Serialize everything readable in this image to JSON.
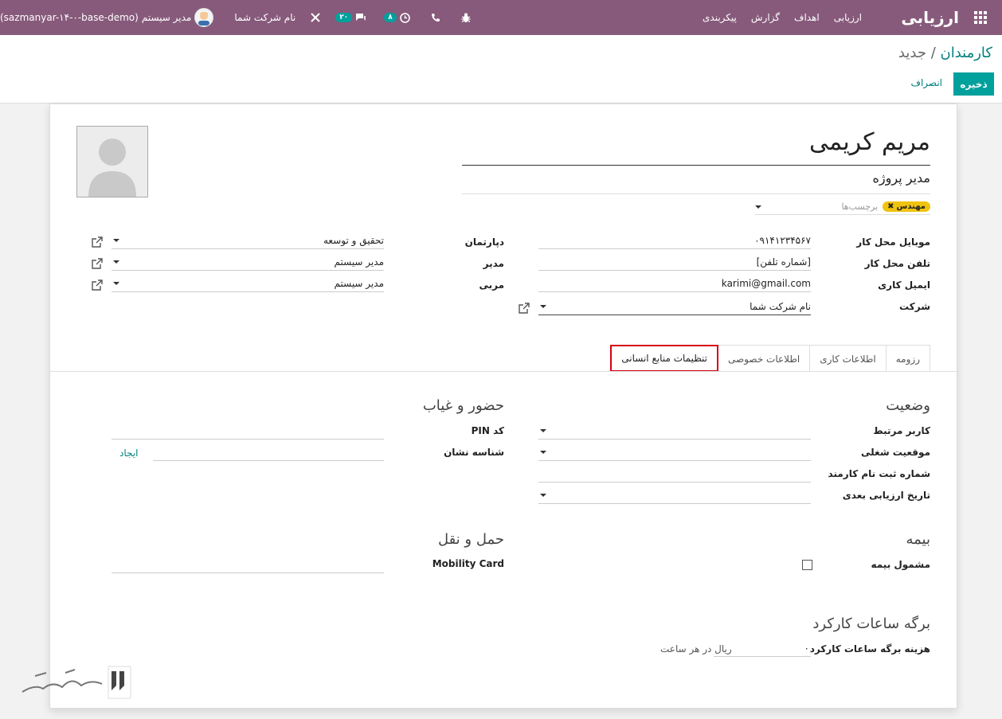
{
  "navbar": {
    "app_name": "ارزیابی",
    "menu": [
      "ارزیابی",
      "اهداف",
      "گزارش",
      "پیکربندی"
    ],
    "db_name": "(sazmanyar-۱۴-۰-base-demo)",
    "user_name": "مدیر سیستم",
    "company": "نام شرکت شما",
    "messages_count": "۲۰",
    "activities_count": "۸"
  },
  "breadcrumb": {
    "parent": "کارمندان",
    "separator": "/",
    "current": "جدید"
  },
  "buttons": {
    "save": "ذخیره",
    "discard": "انصراف"
  },
  "employee": {
    "name": "مریم کریمی",
    "job_title": "مدیر پروژه",
    "tags": [
      "مهندس"
    ],
    "tags_placeholder": "برچسب‌ها"
  },
  "fields_right": [
    {
      "label": "موبایل محل کار",
      "value": "۰۹۱۴۱۲۳۴۵۶۷"
    },
    {
      "label": "تلفن محل کار",
      "value": "[شماره تلفن]"
    },
    {
      "label": "ایمیل کاری",
      "value": "karimi@gmail.com"
    },
    {
      "label": "شرکت",
      "value": "نام شرکت شما"
    }
  ],
  "fields_left": [
    {
      "label": "دپارتمان",
      "value": "تحقیق و توسعه"
    },
    {
      "label": "مدیر",
      "value": "مدیر سیستم"
    },
    {
      "label": "مربی",
      "value": "مدیر سیستم"
    }
  ],
  "tabs": [
    "رزومه",
    "اطلاعات کاری",
    "اطلاعات خصوصی",
    "تنظیمات منابع انسانی"
  ],
  "hr_settings": {
    "status": {
      "title": "وضعیت",
      "related_user": "کاربر مرتبط",
      "job_position": "موقعیت شغلی",
      "registration_number": "شماره ثبت نام کارمند",
      "next_appraisal_date": "تاریخ ارزیابی بعدی"
    },
    "attendance": {
      "title": "حضور و غیاب",
      "pin_code": "کد PIN",
      "badge_id": "شناسه نشان",
      "create_link": "ایجاد"
    },
    "insurance": {
      "title": "بیمه",
      "insured": "مشمول بیمه"
    },
    "transport": {
      "title": "حمل و نقل",
      "mobility_card": "Mobility Card"
    },
    "timesheet": {
      "title": "برگه ساعات کارکرد",
      "cost_label": "هزینه برگه ساعات کارکرد",
      "cost_value": "۰",
      "cost_unit": "ریال در هر ساعت"
    }
  },
  "colors": {
    "navbar": "#875a7b",
    "accent": "#00a09d",
    "tag": "#f0c30f",
    "highlight": "#d60012"
  }
}
